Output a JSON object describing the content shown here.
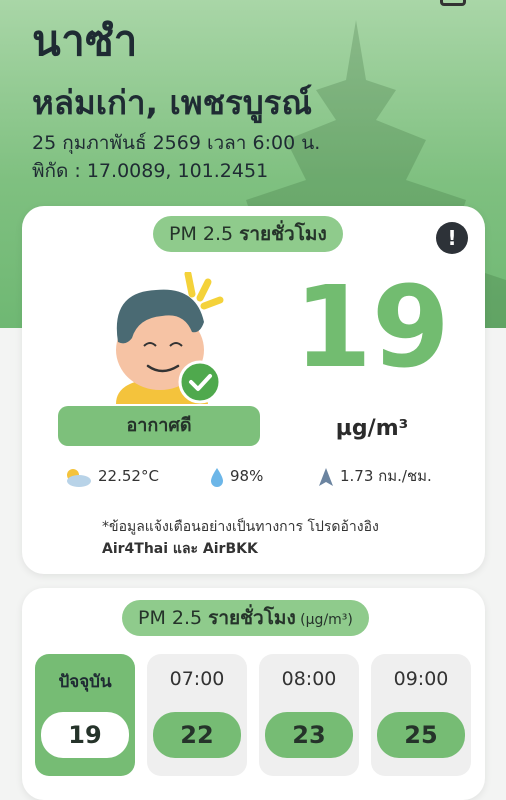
{
  "header": {
    "district": "นาซำ",
    "location": "หล่มเก่า, เพชรบูรณ์",
    "datetime": "25 กุมภาพันธ์ 2569  เวลา 6:00 น.",
    "coordinates": "พิกัด : 17.0089, 101.2451"
  },
  "current": {
    "pill_prefix": "PM 2.5 ",
    "pill_bold": "รายชั่วโมง",
    "pm_value": "19",
    "unit": "µg/m³",
    "status": "อากาศดี",
    "info_symbol": "!",
    "temperature": "22.52°C",
    "humidity": "98%",
    "wind": "1.73 กม./ชม.",
    "notice_line1": "*ข้อมูลแจ้งเตือนอย่างเป็นทางการ โปรดอ้างอิง",
    "notice_line2": "Air4Thai และ AirBKK"
  },
  "hourly": {
    "pill_prefix": "PM 2.5 ",
    "pill_bold": "รายชั่วโมง",
    "pill_unit": " (µg/m³)",
    "slots": [
      {
        "time": "ปัจจุบัน",
        "value": "19"
      },
      {
        "time": "07:00",
        "value": "22"
      },
      {
        "time": "08:00",
        "value": "23"
      },
      {
        "time": "09:00",
        "value": "25"
      }
    ]
  },
  "colors": {
    "accent_green": "#72bc70",
    "pill_green": "#8fcb8c",
    "dark": "#1f2b33"
  },
  "icons": {
    "avatar": "happy-face-icon",
    "check": "check-icon",
    "weather": "partly-cloudy-icon",
    "humidity": "droplet-icon",
    "wind": "wind-arrow-icon"
  }
}
